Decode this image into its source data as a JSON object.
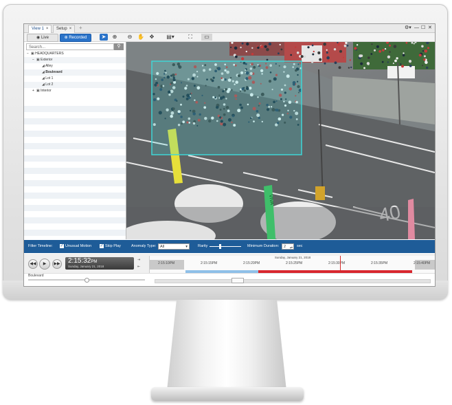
{
  "window": {
    "tabs": [
      {
        "label": "View 1",
        "close": "×"
      },
      {
        "label": "Setup",
        "close": "×"
      }
    ],
    "new_tab": "+",
    "controls": [
      "⚙▾",
      "—",
      "☐",
      "✕"
    ]
  },
  "toolbar": {
    "live_label": "Live",
    "recorded_label": "Recorded",
    "tools": [
      "select-arrow-icon",
      "zoom-in-icon",
      "zoom-out-icon",
      "hand-pan-icon",
      "move-icon",
      "layout-icon",
      "fullscreen-icon",
      "overlay-icon"
    ]
  },
  "sidebar": {
    "search_placeholder": "Search...",
    "tree": [
      {
        "label": "HEADQUARTERS",
        "indent": 0,
        "expander": "−",
        "icon": "building-icon"
      },
      {
        "label": "Exterior",
        "indent": 1,
        "expander": "−",
        "icon": "folder-icon"
      },
      {
        "label": "Alley",
        "indent": 2,
        "icon": "camera-icon"
      },
      {
        "label": "Boulevard",
        "indent": 2,
        "icon": "camera-icon",
        "selected": true
      },
      {
        "label": "Lot 1",
        "indent": 2,
        "icon": "camera-icon"
      },
      {
        "label": "Lot 2",
        "indent": 2,
        "icon": "camera-icon"
      },
      {
        "label": "Interior",
        "indent": 1,
        "expander": "+",
        "icon": "folder-icon"
      }
    ]
  },
  "filter": {
    "title": "Filter Timeline:",
    "unusual_motion": "Unusual Motion",
    "skip_play": "Skip Play",
    "anomaly_type_label": "Anomaly Type:",
    "anomaly_type_value": "All",
    "rarity_label": "Rarity",
    "rarity_level": 0.3,
    "min_duration_label": "Minimum Duration:",
    "min_duration_value": "2",
    "min_duration_unit": "sec"
  },
  "playback": {
    "time": "2:15:32",
    "ampm": "PM",
    "date": "Sunday, January 21, 2018",
    "timeline_date": "Sunday, January 21, 2018",
    "ticks": [
      "2:15:10PM",
      "2:15:15PM",
      "2:15:20PM",
      "2:15:25PM",
      "2:15:30PM",
      "2:15:35PM",
      "2:15:40PM"
    ],
    "camera_label": "Boulevard",
    "colors": {
      "motion": "#8fc0e8",
      "anomaly": "#d8262e",
      "cursor": "#d62a2a"
    }
  },
  "video": {
    "detection_box_color": "#3fd6d6",
    "banner_text": "VIVA"
  }
}
